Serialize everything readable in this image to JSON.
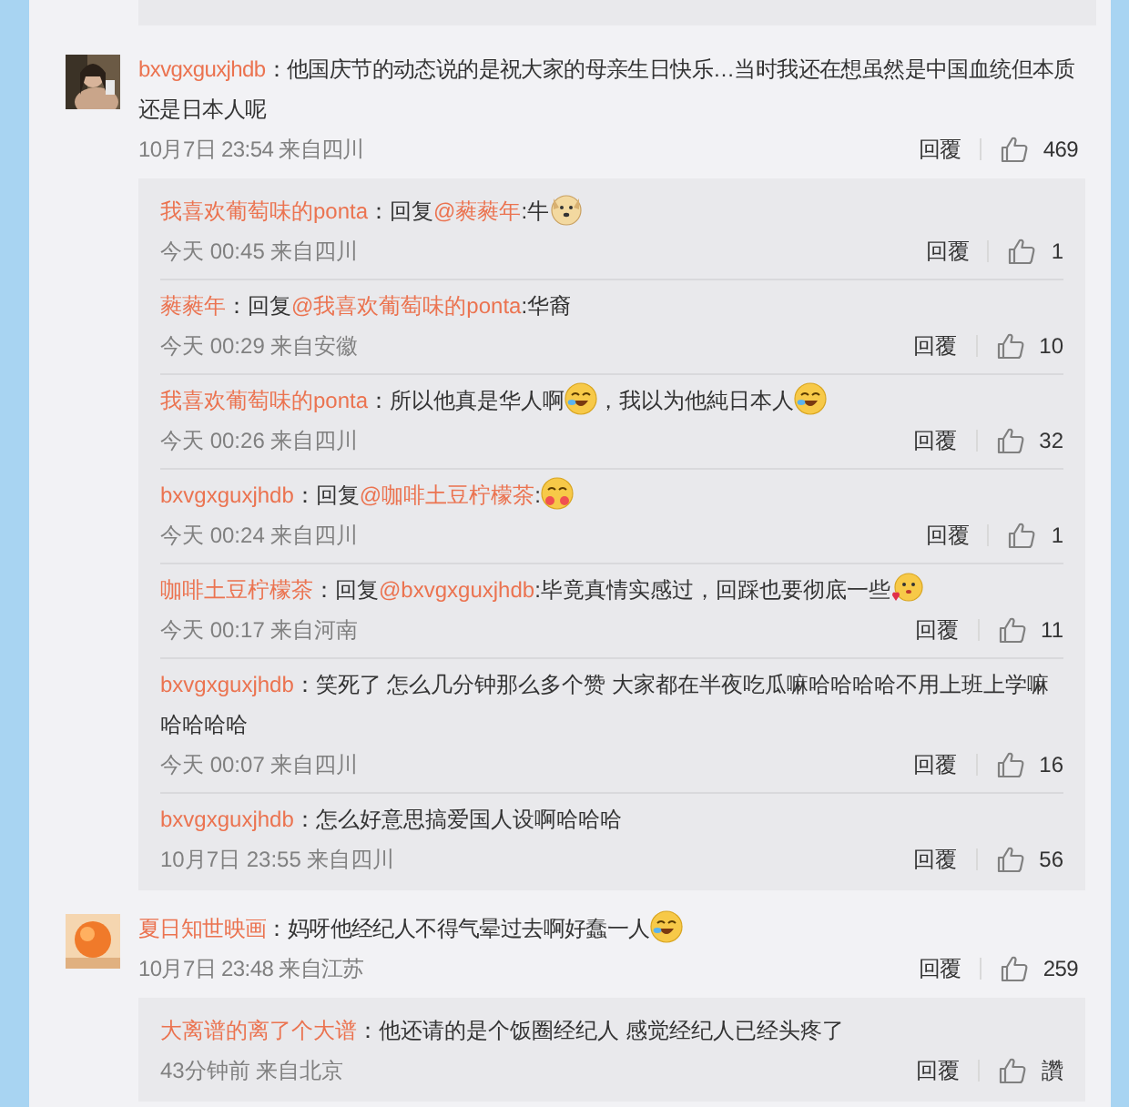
{
  "comments": [
    {
      "user": "bxvgxguxjhdb",
      "avatar": {
        "kind": "picture"
      },
      "content": [
        {
          "kind": "text",
          "text": "："
        },
        {
          "kind": "text",
          "text": "他国庆节的动态说的是祝大家的母亲生日快乐…当时我还在想虽然是中国血统但本质还是日本人呢"
        }
      ],
      "time": "10月7日 23:54",
      "source": "来自四川",
      "reply_label": "回覆",
      "likes": "469",
      "replies": [
        {
          "user": "我喜欢葡萄味的ponta",
          "content": [
            {
              "kind": "text",
              "text": "："
            },
            {
              "kind": "text",
              "text": "回复"
            },
            {
              "kind": "mention",
              "text": "@蕤蕤年"
            },
            {
              "kind": "text",
              "text": ":牛"
            },
            {
              "kind": "dog-emoji"
            }
          ],
          "time": "今天 00:45",
          "source": "来自四川",
          "reply_label": "回覆",
          "likes": "1"
        },
        {
          "user": "蕤蕤年",
          "content": [
            {
              "kind": "text",
              "text": "："
            },
            {
              "kind": "text",
              "text": "回复"
            },
            {
              "kind": "mention",
              "text": "@我喜欢葡萄味的ponta"
            },
            {
              "kind": "text",
              "text": ":华裔"
            }
          ],
          "time": "今天 00:29",
          "source": "来自安徽",
          "reply_label": "回覆",
          "likes": "10"
        },
        {
          "user": "我喜欢葡萄味的ponta",
          "content": [
            {
              "kind": "text",
              "text": "："
            },
            {
              "kind": "text",
              "text": "所以他真是华人啊"
            },
            {
              "kind": "laugh-emoji"
            },
            {
              "kind": "text",
              "text": "，我以为他純日本人"
            },
            {
              "kind": "laugh-emoji"
            }
          ],
          "time": "今天 00:26",
          "source": "来自四川",
          "reply_label": "回覆",
          "likes": "32"
        },
        {
          "user": "bxvgxguxjhdb",
          "content": [
            {
              "kind": "text",
              "text": "："
            },
            {
              "kind": "text",
              "text": "回复"
            },
            {
              "kind": "mention",
              "text": "@咖啡土豆柠檬茶"
            },
            {
              "kind": "text",
              "text": ":"
            },
            {
              "kind": "hug-emoji"
            }
          ],
          "time": "今天 00:24",
          "source": "来自四川",
          "reply_label": "回覆",
          "likes": "1"
        },
        {
          "user": "咖啡土豆柠檬茶",
          "content": [
            {
              "kind": "text",
              "text": "："
            },
            {
              "kind": "text",
              "text": "回复"
            },
            {
              "kind": "mention",
              "text": "@bxvgxguxjhdb"
            },
            {
              "kind": "text",
              "text": ":毕竟真情实感过，回踩也要彻底一些"
            },
            {
              "kind": "heart-emoji"
            }
          ],
          "time": "今天 00:17",
          "source": "来自河南",
          "reply_label": "回覆",
          "likes": "11"
        },
        {
          "user": "bxvgxguxjhdb",
          "content": [
            {
              "kind": "text",
              "text": "："
            },
            {
              "kind": "text",
              "text": "笑死了 怎么几分钟那么多个赞 大家都在半夜吃瓜嘛哈哈哈哈不用上班上学嘛哈哈哈哈"
            }
          ],
          "time": "今天 00:07",
          "source": "来自四川",
          "reply_label": "回覆",
          "likes": "16"
        },
        {
          "user": "bxvgxguxjhdb",
          "content": [
            {
              "kind": "text",
              "text": "："
            },
            {
              "kind": "text",
              "text": "怎么好意思搞爱国人设啊哈哈哈"
            }
          ],
          "time": "10月7日 23:55",
          "source": "来自四川",
          "reply_label": "回覆",
          "likes": "56"
        }
      ]
    },
    {
      "user": "夏日知世映画",
      "avatar": {
        "kind": "picture"
      },
      "content": [
        {
          "kind": "text",
          "text": "："
        },
        {
          "kind": "text",
          "text": "妈呀他经纪人不得气晕过去啊好蠢一人"
        },
        {
          "kind": "laugh-emoji"
        }
      ],
      "time": "10月7日 23:48",
      "source": "来自江苏",
      "reply_label": "回覆",
      "likes": "259",
      "replies": [
        {
          "user": "大离谱的离了个大谱",
          "content": [
            {
              "kind": "text",
              "text": "："
            },
            {
              "kind": "text",
              "text": "他还请的是个饭圈经纪人 感觉经纪人已经头疼了"
            }
          ],
          "time": "43分钟前",
          "source": "来自北京",
          "reply_label": "回覆",
          "likes": "讚"
        }
      ]
    }
  ]
}
